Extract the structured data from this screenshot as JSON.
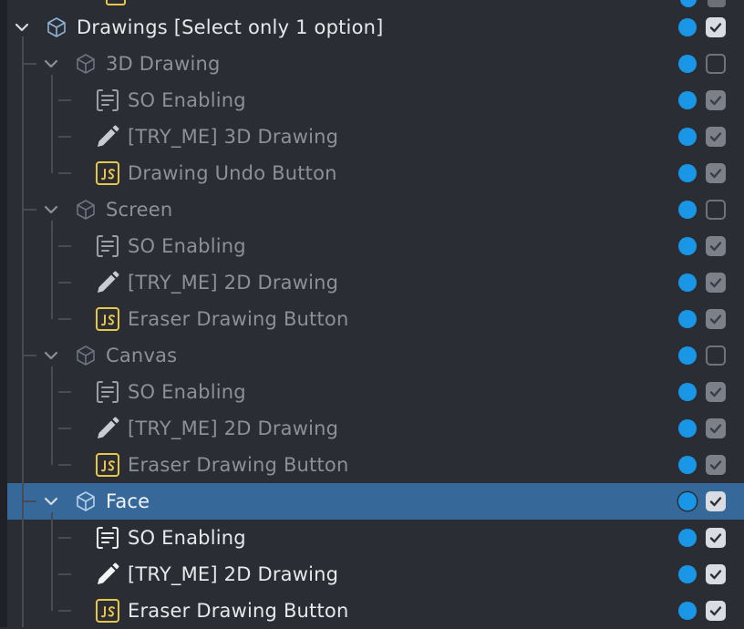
{
  "tree": {
    "root": {
      "label": "Drawings [Select only 1 option]",
      "icon": "cube-icon",
      "active": true,
      "checked": true
    },
    "groups": [
      {
        "label": "3D Drawing",
        "icon": "cube-icon",
        "checked": false,
        "active": false,
        "children": [
          {
            "label": "SO Enabling",
            "icon": "script-icon",
            "checked": true
          },
          {
            "label": "[TRY_ME] 3D Drawing",
            "icon": "pencil-icon",
            "checked": true
          },
          {
            "label": "Drawing Undo Button",
            "icon": "js-icon",
            "checked": true
          }
        ]
      },
      {
        "label": "Screen",
        "icon": "cube-icon",
        "checked": false,
        "active": false,
        "children": [
          {
            "label": "SO Enabling",
            "icon": "script-icon",
            "checked": true
          },
          {
            "label": "[TRY_ME] 2D Drawing",
            "icon": "pencil-icon",
            "checked": true
          },
          {
            "label": "Eraser Drawing Button",
            "icon": "js-icon",
            "checked": true
          }
        ]
      },
      {
        "label": "Canvas",
        "icon": "cube-icon",
        "checked": false,
        "active": false,
        "children": [
          {
            "label": "SO Enabling",
            "icon": "script-icon",
            "checked": true
          },
          {
            "label": "[TRY_ME] 2D Drawing",
            "icon": "pencil-icon",
            "checked": true
          },
          {
            "label": "Eraser Drawing Button",
            "icon": "js-icon",
            "checked": true
          }
        ]
      },
      {
        "label": "Face",
        "icon": "cube-icon",
        "checked": true,
        "active": true,
        "selected": true,
        "children": [
          {
            "label": "SO Enabling",
            "icon": "script-icon",
            "checked": true
          },
          {
            "label": "[TRY_ME] 2D Drawing",
            "icon": "pencil-icon",
            "checked": true
          },
          {
            "label": "Eraser Drawing Button",
            "icon": "js-icon",
            "checked": true
          }
        ]
      }
    ]
  },
  "colors": {
    "background": "#2a2d33",
    "selection": "#36689a",
    "status_dot": "#1996e6",
    "js_icon": "#e8c64a",
    "text_active": "#e6e8ec",
    "text_dim": "#8c9098"
  }
}
